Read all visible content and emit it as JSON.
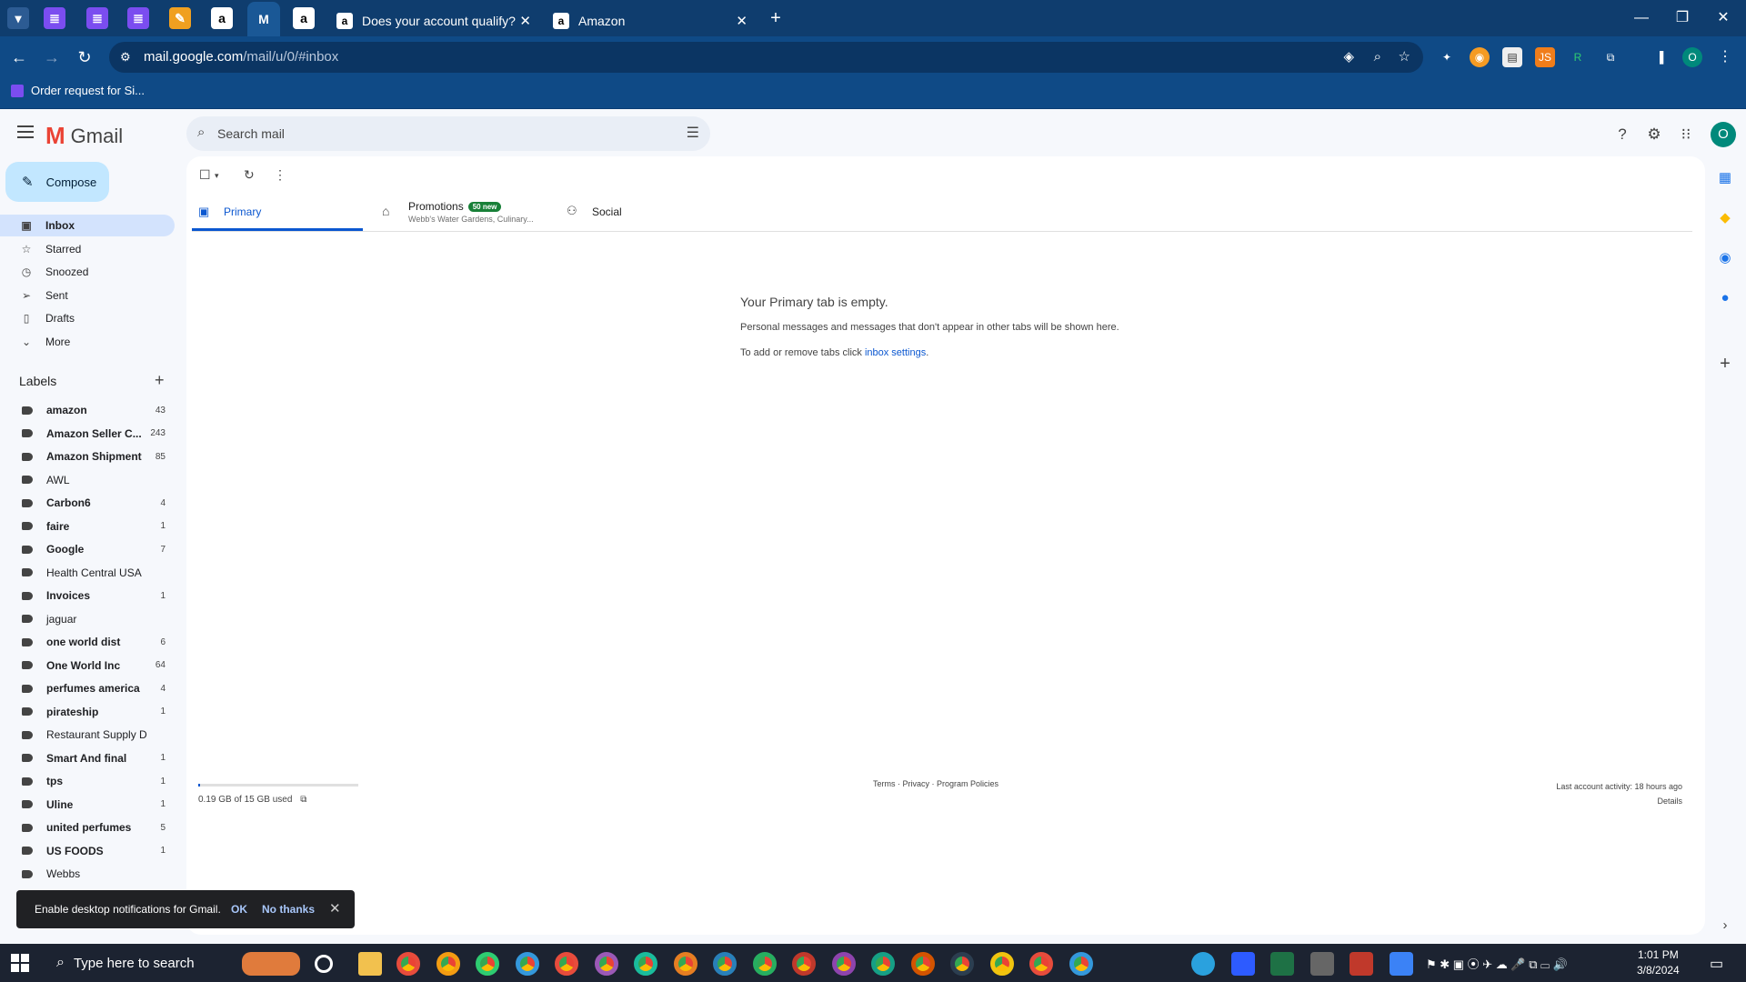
{
  "browser": {
    "tabs": [
      {
        "title": "Does your account qualify?",
        "icon": "amazon-icon"
      },
      {
        "title": "Amazon",
        "icon": "amazon-icon"
      }
    ],
    "address": {
      "host": "mail.google.com",
      "path": "/mail/u/0/#inbox"
    },
    "bookmark": "Order request for Si...",
    "profile_letter": "O"
  },
  "gmail": {
    "app_name": "Gmail",
    "search_placeholder": "Search mail",
    "avatar_letter": "O",
    "compose": "Compose",
    "nav": [
      {
        "label": "Inbox",
        "icon": "inbox-icon"
      },
      {
        "label": "Starred",
        "icon": "star-icon"
      },
      {
        "label": "Snoozed",
        "icon": "clock-icon"
      },
      {
        "label": "Sent",
        "icon": "send-icon"
      },
      {
        "label": "Drafts",
        "icon": "draft-icon"
      },
      {
        "label": "More",
        "icon": "chevron-down-icon"
      }
    ],
    "labels_heading": "Labels",
    "labels": [
      {
        "name": "amazon",
        "count": "43",
        "bold": true
      },
      {
        "name": "Amazon Seller C...",
        "count": "243",
        "bold": true
      },
      {
        "name": "Amazon Shipment",
        "count": "85",
        "bold": true
      },
      {
        "name": "AWL",
        "count": "",
        "bold": false
      },
      {
        "name": "Carbon6",
        "count": "4",
        "bold": true
      },
      {
        "name": "faire",
        "count": "1",
        "bold": true
      },
      {
        "name": "Google",
        "count": "7",
        "bold": true
      },
      {
        "name": "Health Central USA",
        "count": "",
        "bold": false
      },
      {
        "name": "Invoices",
        "count": "1",
        "bold": true
      },
      {
        "name": "jaguar",
        "count": "",
        "bold": false
      },
      {
        "name": "one world dist",
        "count": "6",
        "bold": true
      },
      {
        "name": "One World Inc",
        "count": "64",
        "bold": true
      },
      {
        "name": "perfumes america",
        "count": "4",
        "bold": true
      },
      {
        "name": "pirateship",
        "count": "1",
        "bold": true
      },
      {
        "name": "Restaurant Supply D",
        "count": "",
        "bold": false
      },
      {
        "name": "Smart And final",
        "count": "1",
        "bold": true
      },
      {
        "name": "tps",
        "count": "1",
        "bold": true
      },
      {
        "name": "Uline",
        "count": "1",
        "bold": true
      },
      {
        "name": "united perfumes",
        "count": "5",
        "bold": true
      },
      {
        "name": "US FOODS",
        "count": "1",
        "bold": true
      },
      {
        "name": "Webbs",
        "count": "",
        "bold": false
      }
    ],
    "tabs": {
      "primary": "Primary",
      "promotions": "Promotions",
      "promotions_badge": "50 new",
      "promotions_sub": "Webb's Water Gardens, Culinary...",
      "social": "Social"
    },
    "empty": {
      "heading": "Your Primary tab is empty.",
      "line1": "Personal messages and messages that don't appear in other tabs will be shown here.",
      "line2_prefix": "To add or remove tabs click ",
      "line2_link": "inbox settings",
      "line2_suffix": "."
    },
    "footer": {
      "storage": "0.19 GB of 15 GB used",
      "storage_fraction": 0.013,
      "links": "Terms · Privacy · Program Policies",
      "activity": "Last account activity: 18 hours ago",
      "details": "Details"
    },
    "snackbar": {
      "message": "Enable desktop notifications for Gmail.",
      "ok": "OK",
      "no": "No thanks"
    }
  },
  "taskbar": {
    "search_placeholder": "Type here to search",
    "time": "1:01 PM",
    "date": "3/8/2024"
  },
  "colors": {
    "accent": "#0b57d0",
    "chrome": "#0f3d6e",
    "compose": "#c2e7ff",
    "badge": "#188038"
  }
}
